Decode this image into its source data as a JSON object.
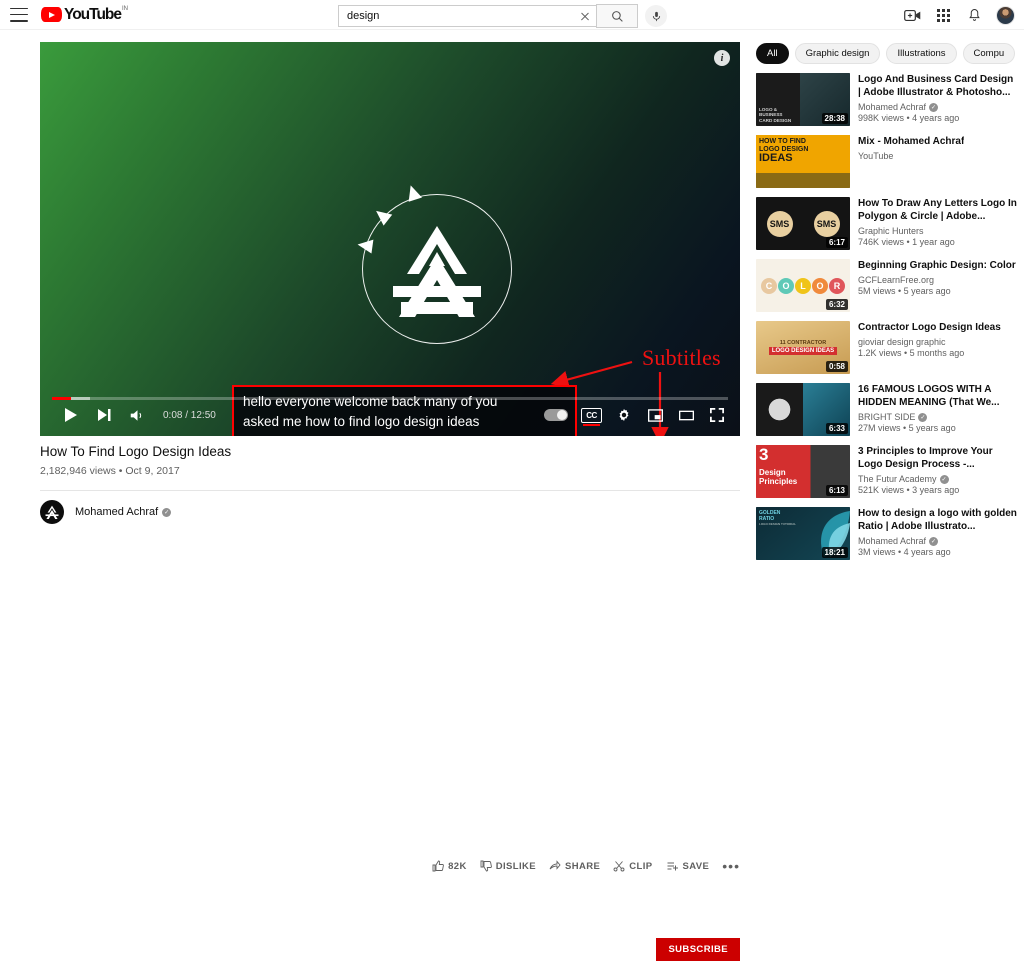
{
  "header": {
    "menu_icon": "hamburger-menu-icon",
    "logo_text": "YouTube",
    "logo_country": "IN",
    "search": {
      "value": "design",
      "placeholder": "Search",
      "clear_icon": "close-icon",
      "search_icon": "search-icon",
      "mic_icon": "microphone-icon"
    },
    "create_icon": "create-video-icon",
    "apps_icon": "apps-grid-icon",
    "notifications_icon": "notifications-bell-icon",
    "avatar_icon": "user-avatar"
  },
  "player": {
    "info_badge": "i",
    "captions": {
      "line1": "hello everyone welcome back many of you",
      "line2": "asked me how to find logo design ideas"
    },
    "annotation": {
      "label": "Subtitles",
      "color": "#ee1111"
    },
    "time": "0:08 / 12:50",
    "controls": {
      "play": "play-button",
      "next": "next-video-button",
      "volume": "volume-button",
      "autoplay": "autoplay-toggle",
      "captions": "CC",
      "settings": "settings-gear-icon",
      "miniplayer": "miniplayer-button",
      "theater": "theater-mode-button",
      "fullscreen": "fullscreen-button"
    }
  },
  "video": {
    "title": "How To Find Logo Design Ideas",
    "meta": "2,182,946 views • Oct 9, 2017",
    "actions": [
      {
        "label": "82K",
        "icon": "thumbs-up-icon",
        "name": "like-button"
      },
      {
        "label": "DISLIKE",
        "icon": "thumbs-down-icon",
        "name": "dislike-button"
      },
      {
        "label": "SHARE",
        "icon": "share-icon",
        "name": "share-button"
      },
      {
        "label": "CLIP",
        "icon": "scissors-icon",
        "name": "clip-button"
      },
      {
        "label": "SAVE",
        "icon": "save-playlist-icon",
        "name": "save-button"
      }
    ],
    "more": "•••",
    "channel": {
      "name": "Mohamed Achraf",
      "verified": "✓",
      "subscribe": "SUBSCRIBE"
    }
  },
  "sidebar": {
    "chips": [
      {
        "label": "All",
        "active": true
      },
      {
        "label": "Graphic design",
        "active": false
      },
      {
        "label": "Illustrations",
        "active": false
      },
      {
        "label": "Compu",
        "active": false
      }
    ],
    "chip_arrow": "›",
    "items": [
      {
        "title": "Logo And Business Card Design | Adobe Illustrator & Photosho...",
        "channel": "Mohamed Achraf",
        "verified": true,
        "stats": "998K views • 4 years ago",
        "duration": "28:38",
        "thumb": "logo-business-card"
      },
      {
        "title": "Mix - Mohamed Achraf",
        "channel": "YouTube",
        "verified": false,
        "stats": "",
        "duration": "",
        "thumb": "mix-logo-ideas"
      },
      {
        "title": "How To Draw Any Letters Logo In Polygon & Circle | Adobe...",
        "channel": "Graphic Hunters",
        "verified": false,
        "stats": "746K views • 1 year ago",
        "duration": "6:17",
        "thumb": "sms-letters"
      },
      {
        "title": "Beginning Graphic Design: Color",
        "channel": "GCFLearnFree.org",
        "verified": false,
        "stats": "5M views • 5 years ago",
        "duration": "6:32",
        "thumb": "color-circles"
      },
      {
        "title": "Contractor Logo Design Ideas",
        "channel": "gioviar design graphic",
        "verified": false,
        "stats": "1.2K views • 5 months ago",
        "duration": "0:58",
        "thumb": "contractor"
      },
      {
        "title": "16 FAMOUS LOGOS WITH A HIDDEN MEANING (That We...",
        "channel": "BRIGHT SIDE",
        "verified": true,
        "stats": "27M views • 5 years ago",
        "duration": "6:33",
        "thumb": "famous-logos"
      },
      {
        "title": "3 Principles to Improve Your Logo Design Process -...",
        "channel": "The Futur Academy",
        "verified": true,
        "stats": "521K views • 3 years ago",
        "duration": "6:13",
        "thumb": "design-principles"
      },
      {
        "title": "How to design a logo with golden Ratio | Adobe Illustrato...",
        "channel": "Mohamed Achraf",
        "verified": true,
        "stats": "3M views • 4 years ago",
        "duration": "18:21",
        "thumb": "golden-ratio"
      }
    ],
    "thumb_text": {
      "logo_card_l1": "LOGO &",
      "logo_card_l2": "BUSINESS",
      "logo_card_l3": "CARD DESIGN",
      "mix_l1": "HOW TO FIND",
      "mix_l2": "LOGO DESIGN",
      "mix_l3": "IDEAS",
      "sms": "SMS",
      "color_letters": [
        "C",
        "O",
        "L",
        "O",
        "R"
      ],
      "contractor_1": "11 CONTRACTOR",
      "contractor_2": "LOGO DESIGN IDEAS",
      "princ_num": "3",
      "princ_l1": "Design",
      "princ_l2": "Principles",
      "golden_l1": "GOLDEN",
      "golden_l2": "RATIO",
      "golden_l3": "LOGO DESIGN TUTORIAL"
    }
  },
  "colors": {
    "brand_red": "#ff0000",
    "subscribe_red": "#cc0000",
    "annotation_red": "#ee1111"
  }
}
